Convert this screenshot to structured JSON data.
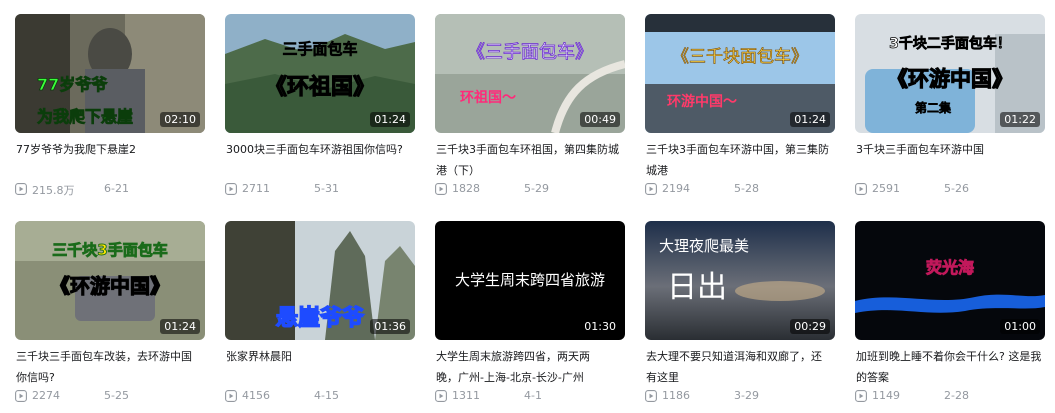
{
  "videos": [
    {
      "title": "77岁爷爷为我爬下悬崖2",
      "duration": "02:10",
      "plays": "215.8万",
      "date": "6-21",
      "thumb_text": [
        "77岁爷爷",
        "为我爬下悬崖"
      ]
    },
    {
      "title": "3000块三手面包车环游祖国你信吗?",
      "duration": "01:24",
      "plays": "2711",
      "date": "5-31",
      "thumb_text": [
        "三手面包车",
        "《环祖国》"
      ]
    },
    {
      "title": "三千块3手面包车环祖国，第四集防城港（下）",
      "duration": "00:49",
      "plays": "1828",
      "date": "5-29",
      "thumb_text": [
        "《三手面包车》",
        "环祖国～"
      ]
    },
    {
      "title": "三千块3手面包车环游中国，第三集防城港",
      "duration": "01:24",
      "plays": "2194",
      "date": "5-28",
      "thumb_text": [
        "《三千块面包车》",
        "环游中国～"
      ]
    },
    {
      "title": "3千块三手面包车环游中国",
      "duration": "01:22",
      "plays": "2591",
      "date": "5-26",
      "thumb_text": [
        "3千块二手面包车！",
        "《环游中国》",
        "第二集"
      ]
    },
    {
      "title": "三千块三手面包车改装，去环游中国你信吗?",
      "duration": "01:24",
      "plays": "2274",
      "date": "5-25",
      "thumb_text": [
        "三千块3手面包车",
        "《环游中国》"
      ]
    },
    {
      "title": "张家界林晨阳",
      "duration": "01:36",
      "plays": "4156",
      "date": "4-15",
      "thumb_text": [
        "悬崖爷爷"
      ]
    },
    {
      "title": "大学生周末旅游跨四省，两天两晚，广州-上海-北京-长沙-广州",
      "duration": "01:30",
      "plays": "1311",
      "date": "4-1",
      "thumb_text": [
        "大学生周末跨四省旅游"
      ]
    },
    {
      "title": "去大理不要只知道洱海和双廊了，还有这里",
      "duration": "00:29",
      "plays": "1186",
      "date": "3-29",
      "thumb_text": [
        "大理夜爬最美",
        "日出"
      ]
    },
    {
      "title": "加班到晚上睡不着你会干什么? 这是我的答案",
      "duration": "01:00",
      "plays": "1149",
      "date": "2-28",
      "thumb_text": [
        "荧光海"
      ]
    }
  ],
  "colors": {
    "meta": "#9499a0",
    "title": "#18191c",
    "duration_bg": "rgba(0,0,0,0.55)"
  }
}
